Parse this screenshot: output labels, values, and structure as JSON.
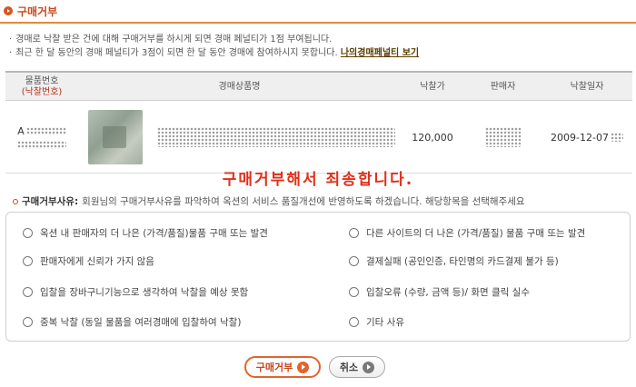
{
  "header": {
    "title": "구매거부"
  },
  "notices": [
    {
      "text": "경매로 낙찰 받은 건에 대해 구매거부를 하시게 되면 경매 페널티가 1점 부여됩니다."
    },
    {
      "text": "최근 한 달 동안의 경매 페널티가 3점이 되면 한 달 동안 경매에 참여하시지 못합니다.",
      "link_label": "나의경매페널티 보기"
    }
  ],
  "table": {
    "headers": {
      "item_no": "물품번호",
      "bid_no": "(낙찰번호)",
      "item_name": "경매상품명",
      "price": "낙찰가",
      "seller": "판매자",
      "date": "낙찰일자"
    },
    "row": {
      "item_no_prefix": "A",
      "price": "120,000",
      "date": "2009-12-07"
    }
  },
  "apology": "구매거부해서 죄송합니다.",
  "reason": {
    "title": "구매거부사유:",
    "description": "회원님의 구매거부사유를 파악하여 옥션의 서비스 품질개선에 반영하도록 하겠습니다. 해당항목을 선택해주세요",
    "options": [
      "옥션 내 판매자의 더 나은 (가격/품질)물품 구매 또는 발견",
      "다른 사이트의 더 나은 (가격/품질) 물품 구매 또는 발견",
      "판매자에게 신뢰가 가지 않음",
      "결제실패 (공인인증, 타인명의 카드결제 불가 등)",
      "입찰을 장바구니기능으로 생각하여 낙찰을 예상 못함",
      "입찰오류 (수량, 금액 등)/ 화면 클릭 실수",
      "중복 낙찰 (동일 물품을 여러경매에 입찰하여 낙찰)",
      "기타 사유"
    ]
  },
  "buttons": {
    "refuse": "구매거부",
    "cancel": "취소"
  },
  "colors": {
    "accent": "#e2642b",
    "apology": "#e0301a",
    "title": "#c9471c"
  }
}
